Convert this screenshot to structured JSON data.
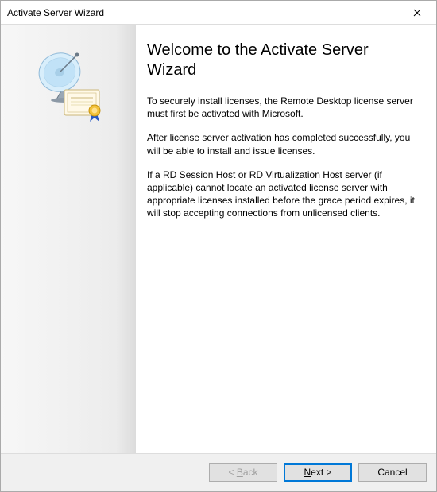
{
  "window": {
    "title": "Activate Server Wizard"
  },
  "icons": {
    "close": "close-icon",
    "wizard_side": "satellite-dish-certificate-icon"
  },
  "main": {
    "heading": "Welcome to the Activate Server Wizard",
    "paragraphs": [
      "To securely install licenses, the Remote Desktop license server must first be activated with Microsoft.",
      "After license server activation has completed successfully, you will be able to install and issue licenses.",
      "If a RD Session Host or RD Virtualization Host server (if applicable) cannot locate an activated license server with appropriate licenses installed before the grace period expires, it will stop accepting connections from unlicensed clients."
    ]
  },
  "buttons": {
    "back": {
      "prefix": "< ",
      "mnemonic": "B",
      "rest": "ack",
      "enabled": false
    },
    "next": {
      "mnemonic": "N",
      "rest": "ext >",
      "enabled": true,
      "default": true
    },
    "cancel": {
      "label": "Cancel",
      "enabled": true
    }
  }
}
